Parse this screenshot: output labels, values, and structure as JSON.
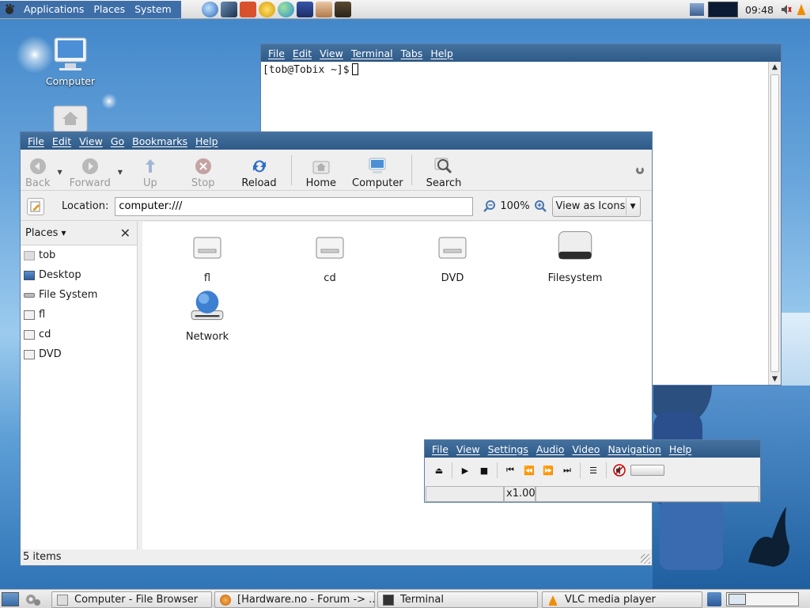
{
  "top_panel": {
    "menus": [
      "Applications",
      "Places",
      "System"
    ],
    "clock": "09:48"
  },
  "desktop": {
    "icons": [
      "Computer"
    ]
  },
  "terminal": {
    "menu": [
      "File",
      "Edit",
      "View",
      "Terminal",
      "Tabs",
      "Help"
    ],
    "prompt": "[tob@Tobix ~]$"
  },
  "file_browser": {
    "menu": [
      "File",
      "Edit",
      "View",
      "Go",
      "Bookmarks",
      "Help"
    ],
    "toolbar": {
      "back": "Back",
      "forward": "Forward",
      "up": "Up",
      "stop": "Stop",
      "reload": "Reload",
      "home": "Home",
      "computer": "Computer",
      "search": "Search"
    },
    "location_label": "Location:",
    "location_value": "computer:///",
    "zoom": "100%",
    "view_mode": "View as Icons",
    "side_pane_title": "Places",
    "places": [
      "tob",
      "Desktop",
      "File System",
      "fl",
      "cd",
      "DVD"
    ],
    "items": [
      "fl",
      "cd",
      "DVD",
      "Filesystem",
      "Network"
    ],
    "status": "5 items"
  },
  "vlc": {
    "menu": [
      "File",
      "View",
      "Settings",
      "Audio",
      "Video",
      "Navigation",
      "Help"
    ],
    "speed": "x1.00"
  },
  "taskbar": {
    "tasks": [
      "Computer - File Browser",
      "[Hardware.no - Forum -> ...",
      "Terminal",
      "VLC media player"
    ]
  },
  "colors": {
    "menubar": "#35608e",
    "app_menu": "#3d6ea8",
    "desktop": "#6aa6dc"
  }
}
